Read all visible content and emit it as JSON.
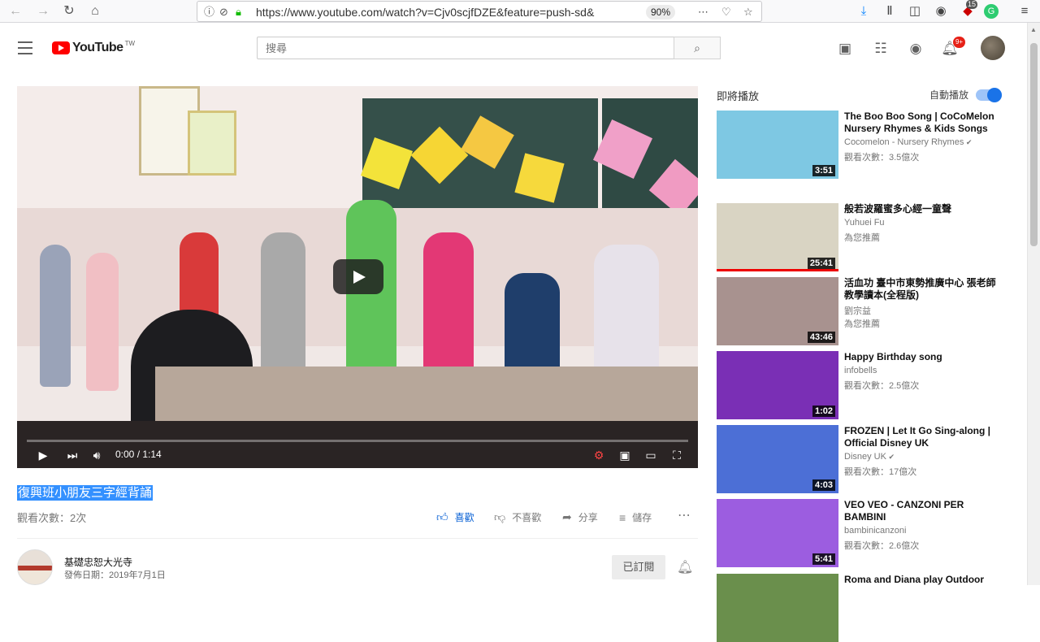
{
  "browser": {
    "url": "https://www.youtube.com/watch?v=Cjv0scjfDZE&feature=push-sd&",
    "zoom": "90%",
    "extension_badge": "15"
  },
  "masthead": {
    "logo_text": "YouTube",
    "logo_tm": "TW",
    "search_placeholder": "搜尋",
    "notification_count": "9+"
  },
  "player": {
    "time": "0:00 / 1:14",
    "progress": 0
  },
  "video": {
    "title": "復興班小朋友三字經背誦",
    "views": "觀看次數：2次",
    "like_label": "喜歡",
    "dislike_label": "不喜歡",
    "share_label": "分享",
    "save_label": "儲存"
  },
  "channel": {
    "name": "基礎忠恕大光寺",
    "publish_date": "發佈日期：2019年7月1日",
    "subscribed_label": "已訂閱"
  },
  "sidebar": {
    "up_next": "即將播放",
    "autoplay": "自動播放",
    "autoplay_on": true,
    "items": [
      {
        "title": "The Boo Boo Song | CoCoMelon Nursery Rhymes & Kids Songs",
        "channel": "Cocomelon - Nursery Rhymes",
        "verified": true,
        "meta": "觀看次數：3.5億次",
        "duration": "3:51",
        "thumb_color": "#7ec8e3"
      },
      {
        "title": "般若波羅蜜多心經一童聲",
        "channel": "Yuhuei Fu",
        "meta": "為您推薦",
        "duration": "25:41",
        "thumb_color": "#d9d4c3"
      },
      {
        "title": "活血功 臺中市東勢推廣中心 張老師 教學讀本(全程版)",
        "channel": "劉宗益",
        "meta": "為您推薦",
        "duration": "43:46",
        "thumb_color": "#a8928f"
      },
      {
        "title": "Happy Birthday song",
        "channel": "infobells",
        "meta": "觀看次數：2.5億次",
        "duration": "1:02",
        "thumb_color": "#7a2fb5"
      },
      {
        "title": "FROZEN | Let It Go Sing-along | Official Disney UK",
        "channel": "Disney UK",
        "verified": true,
        "meta": "觀看次數：17億次",
        "duration": "4:03",
        "thumb_color": "#4c6fd6"
      },
      {
        "title": "VEO VEO - CANZONI PER BAMBINI",
        "channel": "bambinicanzoni",
        "meta": "觀看次數：2.6億次",
        "duration": "5:41",
        "thumb_color": "#9c5de0"
      },
      {
        "title": "Roma and Diana play Outdoor",
        "channel": "",
        "meta": "",
        "duration": "",
        "thumb_color": "#6a8f4c"
      }
    ]
  }
}
